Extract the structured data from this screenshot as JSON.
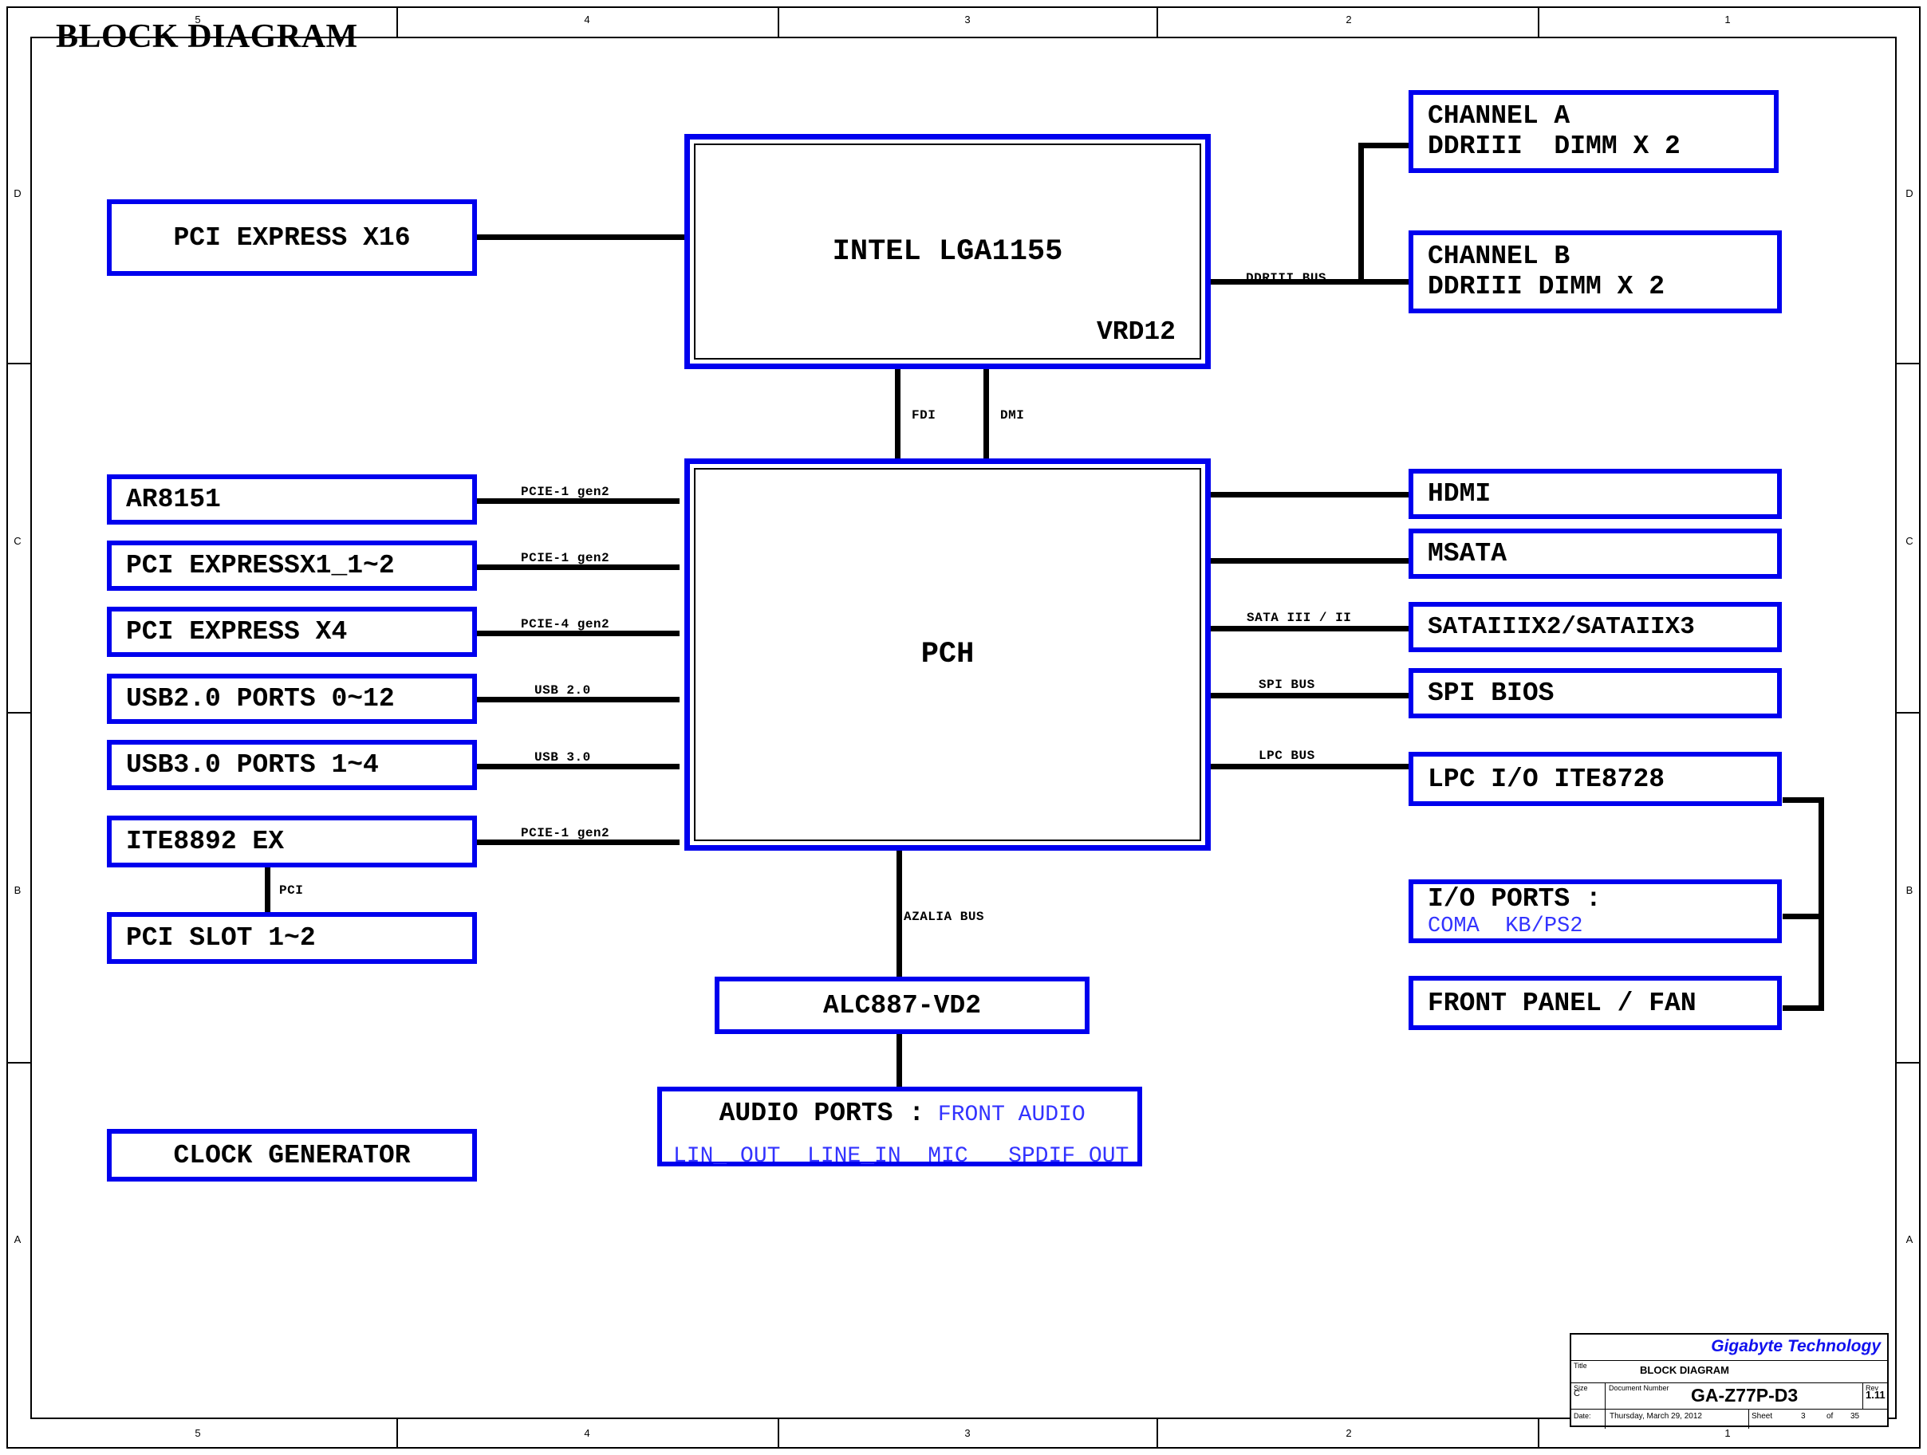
{
  "page": {
    "title": "BLOCK DIAGRAM",
    "accent_blue": "#0000ee",
    "text_blue": "#3333ff",
    "zone_numbers": [
      "5",
      "4",
      "3",
      "2",
      "1"
    ],
    "zone_letters": [
      "D",
      "C",
      "B",
      "A"
    ]
  },
  "blocks": {
    "pci_express_x16": "PCI EXPRESS X16",
    "cpu": {
      "name": "INTEL LGA1155",
      "sub": "VRD12"
    },
    "channel_a": {
      "line1": "CHANNEL A",
      "line2": "DDRIII  DIMM X 2"
    },
    "channel_b": {
      "line1": "CHANNEL B",
      "line2": "DDRIII DIMM X 2"
    },
    "ar8151": "AR8151",
    "pci_expressx1": "PCI EXPRESSX1_1~2",
    "pci_express_x4": "PCI EXPRESS X4",
    "usb20_ports": "USB2.0 PORTS 0~12",
    "usb30_ports": "USB3.0 PORTS 1~4",
    "ite8892ex": "ITE8892 EX",
    "pci_slot": "PCI SLOT 1~2",
    "clock_generator": "CLOCK GENERATOR",
    "pch": "PCH",
    "hdmi": "HDMI",
    "msata": "MSATA",
    "sata_ports": "SATAIIIX2/SATAIIX3",
    "spi_bios": "SPI BIOS",
    "lpc_io": "LPC I/O ITE8728",
    "io_ports": {
      "line1": "I/O PORTS :",
      "line2": "COMA  KB/PS2"
    },
    "front_panel": "FRONT PANEL / FAN",
    "alc887": "ALC887-VD2",
    "audio_ports": {
      "line1_black": "AUDIO PORTS :",
      "line1_blue": " FRONT AUDIO",
      "line2_blue": "LIN_ OUT  LINE_IN  MIC   SPDIF OUT"
    }
  },
  "bus_labels": {
    "ddriii": "DDRIII BUS",
    "fdi": "FDI",
    "dmi": "DMI",
    "pcie1_gen2_a": "PCIE-1 gen2",
    "pcie1_gen2_b": "PCIE-1 gen2",
    "pcie4_gen2": "PCIE-4 gen2",
    "usb20": "USB 2.0",
    "usb30": "USB 3.0",
    "pcie1_gen2_c": "PCIE-1 gen2",
    "pci": "PCI",
    "sata": "SATA III / II",
    "spi": "SPI BUS",
    "lpc": "LPC BUS",
    "azalia": "AZALIA BUS"
  },
  "titleblock": {
    "company": "Gigabyte Technology",
    "title_label": "Title",
    "title_value": "BLOCK DIAGRAM",
    "size_label": "Size",
    "size_value": "C",
    "docnum_label": "Document Number",
    "docnum_value": "GA-Z77P-D3",
    "rev_label": "Rev",
    "rev_value": "1.11",
    "date_label": "Date:",
    "date_value": "Thursday, March 29, 2012",
    "sheet_label": "Sheet",
    "sheet_number": "3",
    "sheet_of": "of",
    "sheet_total": "35"
  }
}
